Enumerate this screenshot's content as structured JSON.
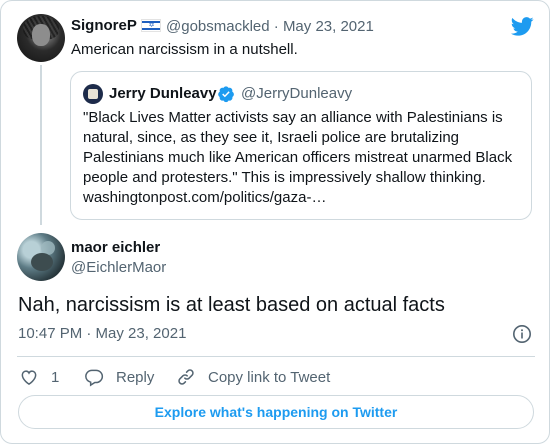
{
  "parent_tweet": {
    "author_name": "SignoreP",
    "flag_icon": "israel-flag-icon",
    "handle": "@gobsmackled · May 23, 2021",
    "text": "American narcissism in a nutshell."
  },
  "quoted_tweet": {
    "author_name": "Jerry Dunleavy",
    "verified": true,
    "handle": "@JerryDunleavy",
    "text": "\"Black Lives Matter activists say an alliance with Palestinians is natural, since, as they see it, Israeli police are brutalizing Palestinians much like American officers mistreat unarmed Black people and protesters.\" This is impressively shallow thinking. washingtonpost.com/politics/gaza-…"
  },
  "reply_tweet": {
    "author_name": "maor eichler",
    "handle": "@EichlerMaor",
    "text": "Nah, narcissism is at least based on actual facts",
    "timestamp": "10:47 PM · May 23, 2021"
  },
  "actions": {
    "like_count": "1",
    "reply_label": "Reply",
    "copy_label": "Copy link to Tweet"
  },
  "explore_label": "Explore what's happening on Twitter",
  "colors": {
    "accent": "#1d9bf0",
    "secondary_text": "#536471",
    "border": "#cfd9de"
  }
}
